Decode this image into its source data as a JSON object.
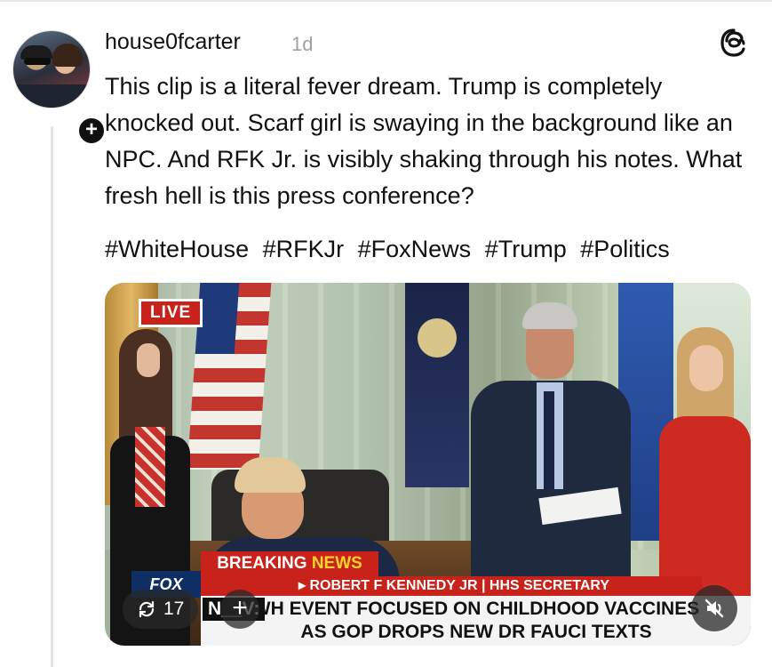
{
  "post": {
    "username": "house0fcarter",
    "time": "1d",
    "text": "This clip is a literal fever dream. Trump is completely knocked out. Scarf girl is swaying in the background like an NPC. And RFK Jr. is visibly shaking through his notes. What fresh hell is this press conference?",
    "hashtags": [
      "#WhiteHouse",
      "#RFKJr",
      "#FoxNews",
      "#Trump",
      "#Politics"
    ],
    "follow_label": "+",
    "icons": {
      "app": "threads-icon",
      "avatar": "avatar",
      "repost": "repost-icon",
      "mute": "muted-speaker-icon"
    }
  },
  "video": {
    "live_label": "LIVE",
    "breaking_label": "BREAKING",
    "news_label": "NEWS",
    "name_bar": "▸ ROBERT F KENNEDY JR | HHS SECRETARY",
    "fox_logo": "FOX",
    "headline_prefix": "N__V:",
    "headline_line1": "WH EVENT FOCUSED ON CHILDHOOD VACCINES",
    "headline_line2": "AS GOP DROPS NEW DR FAUCI TEXTS",
    "repost_count": "17",
    "add_label": "+"
  },
  "colors": {
    "text": "#111111",
    "muted": "#a0a0a0",
    "live_red": "#c8221b",
    "news_yellow": "#ffd42a"
  }
}
